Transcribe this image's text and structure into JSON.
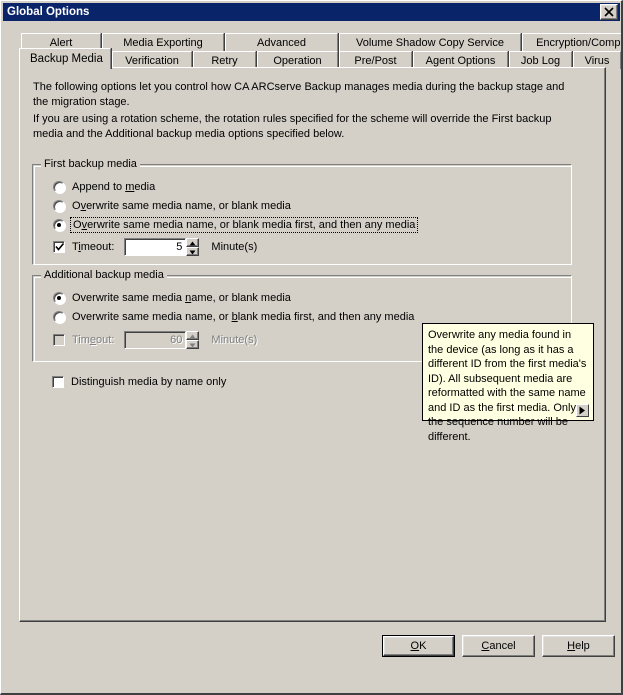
{
  "window": {
    "title": "Global Options",
    "close_icon": "close-icon"
  },
  "tabs": {
    "top_row": [
      {
        "label": "Alert"
      },
      {
        "label": "Media Exporting"
      },
      {
        "label": "Advanced"
      },
      {
        "label": "Volume Shadow Copy Service"
      },
      {
        "label": "Encryption/Compression"
      }
    ],
    "bottom_row": [
      {
        "label": "Backup Media",
        "active": true
      },
      {
        "label": "Verification"
      },
      {
        "label": "Retry"
      },
      {
        "label": "Operation"
      },
      {
        "label": "Pre/Post"
      },
      {
        "label": "Agent Options"
      },
      {
        "label": "Job Log"
      },
      {
        "label": "Virus"
      }
    ]
  },
  "content": {
    "intro_paragraph_1": "The following options let you control how CA ARCserve Backup manages media during the backup stage and the migration stage.",
    "intro_paragraph_2": "If you are using a rotation scheme, the rotation rules specified for the scheme will override the First backup media and the Additional backup media options specified below.",
    "first_backup_media": {
      "group_title": "First backup media",
      "options": [
        {
          "label": "Append to media",
          "selected": false
        },
        {
          "label": "Overwrite same media name, or blank media",
          "selected": false
        },
        {
          "label": "Overwrite same media name, or blank media first, and then any media",
          "selected": true,
          "focused": true
        }
      ],
      "timeout": {
        "label": "Timeout:",
        "checked": true,
        "enabled": true,
        "value": "5",
        "unit": "Minute(s)"
      }
    },
    "additional_backup_media": {
      "group_title": "Additional backup media",
      "options": [
        {
          "label": "Overwrite same media name, or blank media",
          "selected": true
        },
        {
          "label": "Overwrite same media name, or blank media first, and then any media",
          "selected": false
        }
      ],
      "timeout": {
        "label": "Timeout:",
        "checked": false,
        "enabled": false,
        "value": "60",
        "unit": "Minute(s)"
      }
    },
    "distinguish_media": {
      "label": "Distinguish media by name only",
      "checked": false
    }
  },
  "tooltip": {
    "text": "Overwrite any media found in the device (as long as it has a different ID from the first media's ID).  All subsequent media are reformatted with the same name and ID as the first media.  Only the sequence number will be different.",
    "arrow_icon": "play-arrow-icon"
  },
  "footer": {
    "ok_label": "OK",
    "cancel_label": "Cancel",
    "help_label": "Help"
  },
  "colors": {
    "titlebar": "#0a246a",
    "dialog_face": "#d4d0c8",
    "tooltip_bg": "#ffffe1",
    "disabled_text": "#808080"
  }
}
